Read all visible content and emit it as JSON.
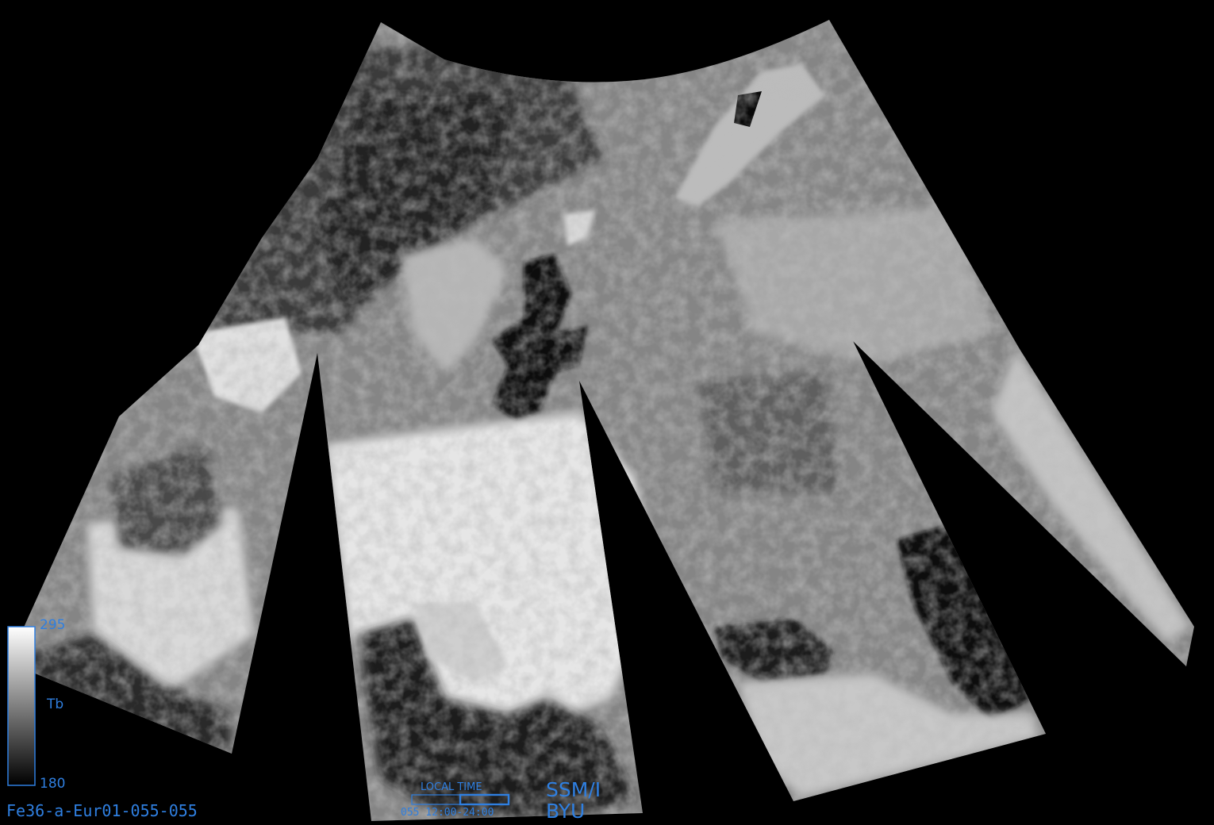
{
  "colorbar": {
    "max": "295",
    "min": "180",
    "variable": "Tb",
    "gradient_top": "#ffffff",
    "gradient_bottom": "#000000",
    "frame_color": "#2f7fe0"
  },
  "image_id": "Fe36-a-Eur01-055-055",
  "local_time": {
    "title": "LOCAL TIME",
    "range": "055  12:00-24:00",
    "window": [
      12,
      24
    ]
  },
  "sensor": "SSM/I",
  "organization": "BYU",
  "colors": {
    "label": "#2f7fe0",
    "background": "#000000"
  }
}
